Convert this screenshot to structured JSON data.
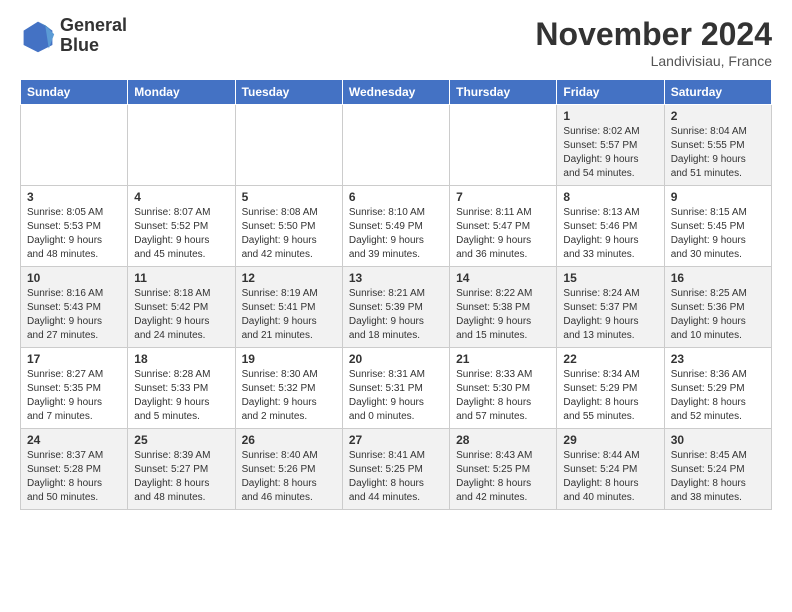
{
  "header": {
    "logo_line1": "General",
    "logo_line2": "Blue",
    "month": "November 2024",
    "location": "Landivisiau, France"
  },
  "days_of_week": [
    "Sunday",
    "Monday",
    "Tuesday",
    "Wednesday",
    "Thursday",
    "Friday",
    "Saturday"
  ],
  "weeks": [
    [
      {
        "day": "",
        "info": ""
      },
      {
        "day": "",
        "info": ""
      },
      {
        "day": "",
        "info": ""
      },
      {
        "day": "",
        "info": ""
      },
      {
        "day": "",
        "info": ""
      },
      {
        "day": "1",
        "info": "Sunrise: 8:02 AM\nSunset: 5:57 PM\nDaylight: 9 hours\nand 54 minutes."
      },
      {
        "day": "2",
        "info": "Sunrise: 8:04 AM\nSunset: 5:55 PM\nDaylight: 9 hours\nand 51 minutes."
      }
    ],
    [
      {
        "day": "3",
        "info": "Sunrise: 8:05 AM\nSunset: 5:53 PM\nDaylight: 9 hours\nand 48 minutes."
      },
      {
        "day": "4",
        "info": "Sunrise: 8:07 AM\nSunset: 5:52 PM\nDaylight: 9 hours\nand 45 minutes."
      },
      {
        "day": "5",
        "info": "Sunrise: 8:08 AM\nSunset: 5:50 PM\nDaylight: 9 hours\nand 42 minutes."
      },
      {
        "day": "6",
        "info": "Sunrise: 8:10 AM\nSunset: 5:49 PM\nDaylight: 9 hours\nand 39 minutes."
      },
      {
        "day": "7",
        "info": "Sunrise: 8:11 AM\nSunset: 5:47 PM\nDaylight: 9 hours\nand 36 minutes."
      },
      {
        "day": "8",
        "info": "Sunrise: 8:13 AM\nSunset: 5:46 PM\nDaylight: 9 hours\nand 33 minutes."
      },
      {
        "day": "9",
        "info": "Sunrise: 8:15 AM\nSunset: 5:45 PM\nDaylight: 9 hours\nand 30 minutes."
      }
    ],
    [
      {
        "day": "10",
        "info": "Sunrise: 8:16 AM\nSunset: 5:43 PM\nDaylight: 9 hours\nand 27 minutes."
      },
      {
        "day": "11",
        "info": "Sunrise: 8:18 AM\nSunset: 5:42 PM\nDaylight: 9 hours\nand 24 minutes."
      },
      {
        "day": "12",
        "info": "Sunrise: 8:19 AM\nSunset: 5:41 PM\nDaylight: 9 hours\nand 21 minutes."
      },
      {
        "day": "13",
        "info": "Sunrise: 8:21 AM\nSunset: 5:39 PM\nDaylight: 9 hours\nand 18 minutes."
      },
      {
        "day": "14",
        "info": "Sunrise: 8:22 AM\nSunset: 5:38 PM\nDaylight: 9 hours\nand 15 minutes."
      },
      {
        "day": "15",
        "info": "Sunrise: 8:24 AM\nSunset: 5:37 PM\nDaylight: 9 hours\nand 13 minutes."
      },
      {
        "day": "16",
        "info": "Sunrise: 8:25 AM\nSunset: 5:36 PM\nDaylight: 9 hours\nand 10 minutes."
      }
    ],
    [
      {
        "day": "17",
        "info": "Sunrise: 8:27 AM\nSunset: 5:35 PM\nDaylight: 9 hours\nand 7 minutes."
      },
      {
        "day": "18",
        "info": "Sunrise: 8:28 AM\nSunset: 5:33 PM\nDaylight: 9 hours\nand 5 minutes."
      },
      {
        "day": "19",
        "info": "Sunrise: 8:30 AM\nSunset: 5:32 PM\nDaylight: 9 hours\nand 2 minutes."
      },
      {
        "day": "20",
        "info": "Sunrise: 8:31 AM\nSunset: 5:31 PM\nDaylight: 9 hours\nand 0 minutes."
      },
      {
        "day": "21",
        "info": "Sunrise: 8:33 AM\nSunset: 5:30 PM\nDaylight: 8 hours\nand 57 minutes."
      },
      {
        "day": "22",
        "info": "Sunrise: 8:34 AM\nSunset: 5:29 PM\nDaylight: 8 hours\nand 55 minutes."
      },
      {
        "day": "23",
        "info": "Sunrise: 8:36 AM\nSunset: 5:29 PM\nDaylight: 8 hours\nand 52 minutes."
      }
    ],
    [
      {
        "day": "24",
        "info": "Sunrise: 8:37 AM\nSunset: 5:28 PM\nDaylight: 8 hours\nand 50 minutes."
      },
      {
        "day": "25",
        "info": "Sunrise: 8:39 AM\nSunset: 5:27 PM\nDaylight: 8 hours\nand 48 minutes."
      },
      {
        "day": "26",
        "info": "Sunrise: 8:40 AM\nSunset: 5:26 PM\nDaylight: 8 hours\nand 46 minutes."
      },
      {
        "day": "27",
        "info": "Sunrise: 8:41 AM\nSunset: 5:25 PM\nDaylight: 8 hours\nand 44 minutes."
      },
      {
        "day": "28",
        "info": "Sunrise: 8:43 AM\nSunset: 5:25 PM\nDaylight: 8 hours\nand 42 minutes."
      },
      {
        "day": "29",
        "info": "Sunrise: 8:44 AM\nSunset: 5:24 PM\nDaylight: 8 hours\nand 40 minutes."
      },
      {
        "day": "30",
        "info": "Sunrise: 8:45 AM\nSunset: 5:24 PM\nDaylight: 8 hours\nand 38 minutes."
      }
    ]
  ]
}
